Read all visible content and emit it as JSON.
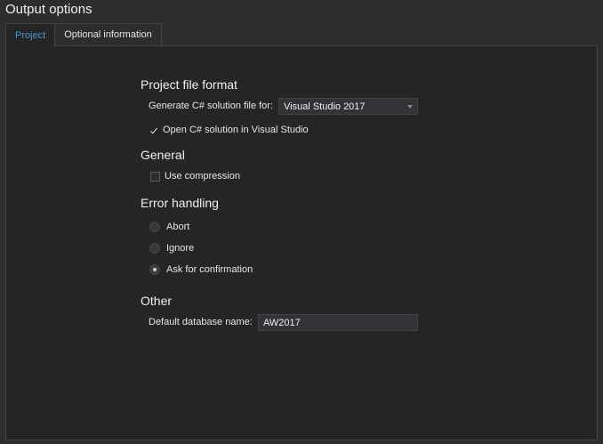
{
  "window": {
    "title": "Output options"
  },
  "tabs": [
    {
      "label": "Project",
      "active": true
    },
    {
      "label": "Optional information",
      "active": false
    }
  ],
  "project_file_format": {
    "title": "Project file format",
    "generate_label": "Generate C# solution file for:",
    "generate_value": "Visual Studio 2017",
    "open_in_vs_label": "Open C# solution in Visual Studio",
    "open_in_vs_checked": true
  },
  "general": {
    "title": "General",
    "use_compression_label": "Use compression",
    "use_compression_checked": false
  },
  "error_handling": {
    "title": "Error handling",
    "options": [
      {
        "label": "Abort",
        "selected": false
      },
      {
        "label": "Ignore",
        "selected": false
      },
      {
        "label": "Ask for confirmation",
        "selected": true
      }
    ]
  },
  "other": {
    "title": "Other",
    "db_name_label": "Default database name:",
    "db_name_value": "AW2017"
  },
  "colors": {
    "background": "#2d2d30",
    "panel": "#252526",
    "accent": "#3b9ae1",
    "text": "#e6e6e6"
  }
}
